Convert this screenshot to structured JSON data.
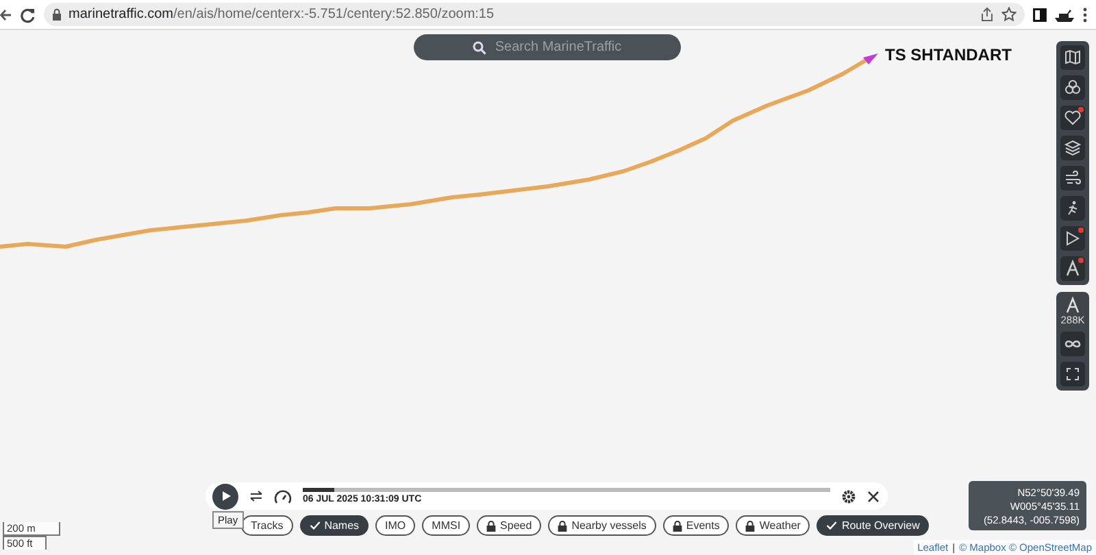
{
  "browser": {
    "url_host": "marinetraffic.com",
    "url_path": "/en/ais/home/centerx:-5.751/centery:52.850/zoom:15"
  },
  "search": {
    "placeholder": "Search MarineTraffic"
  },
  "vessel": {
    "name": "TS SHTANDART"
  },
  "map_tools": [
    {
      "kind": "map",
      "badge": false
    },
    {
      "kind": "filter",
      "badge": false
    },
    {
      "kind": "heart",
      "badge": true
    },
    {
      "kind": "layers",
      "badge": false
    },
    {
      "kind": "wind",
      "badge": false
    },
    {
      "kind": "figure",
      "badge": false
    },
    {
      "kind": "play",
      "badge": true
    },
    {
      "kind": "compass",
      "badge": true
    }
  ],
  "map_tools_2": {
    "count": "288K"
  },
  "playback": {
    "level": 0.06,
    "timestamp": "06 JUL 2025 10:31:09 UTC",
    "tooltip": "Play"
  },
  "filters": [
    {
      "label": "Tracks",
      "kind": "plain",
      "selected": false
    },
    {
      "label": "Names",
      "kind": "check",
      "selected": true
    },
    {
      "label": "IMO",
      "kind": "plain",
      "selected": false
    },
    {
      "label": "MMSI",
      "kind": "plain",
      "selected": false
    },
    {
      "label": "Speed",
      "kind": "lock",
      "selected": false
    },
    {
      "label": "Nearby vessels",
      "kind": "lock",
      "selected": false
    },
    {
      "label": "Events",
      "kind": "lock",
      "selected": false
    },
    {
      "label": "Weather",
      "kind": "lock",
      "selected": false
    },
    {
      "label": "Route Overview",
      "kind": "check",
      "selected": true
    }
  ],
  "coordinates": [
    "N52°50'39.49",
    "W005°45'35.11",
    "(52.8443, -005.7598)"
  ],
  "scale": [
    "200 m",
    "500 ft"
  ],
  "attribution": {
    "links": [
      "Leaflet",
      "© Mapbox © OpenStreetMap"
    ],
    "separator": "|"
  }
}
